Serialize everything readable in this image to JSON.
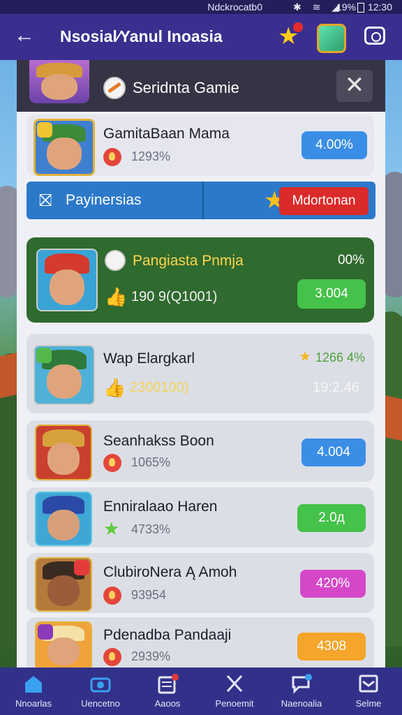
{
  "status_bar": {
    "left": "Ndckrocatb0",
    "battery": "19%",
    "time": "12:30"
  },
  "app_bar": {
    "title": "Nsosial∕Yanul Inoasia"
  },
  "header": {
    "title": "Seridnta Gamie"
  },
  "cards": [
    {
      "name": "GamitaBaan Mama",
      "sub": "1293%",
      "action": "4.00%",
      "color": "#3a8ee6"
    },
    {
      "name": "Pangiasta Pnmja",
      "sub": "190 9(Q1001)",
      "top_right": "00%",
      "action": "3.004",
      "color": "#45c24a"
    },
    {
      "name": "Wap Elargkarl",
      "sub": "2300100)",
      "top_right": "1266 4%",
      "bottom_right": "19:2.46"
    },
    {
      "name": "Seanhakss Boon",
      "sub": "1065%",
      "action": "4.004",
      "color": "#3a8ee6"
    },
    {
      "name": "Enniralaao Haren",
      "sub": "4733%",
      "action": "2.0д",
      "color": "#45c24a"
    },
    {
      "name": "ClubiroNera Ą Amoh",
      "sub": "93954",
      "action": "420%",
      "color": "#d448c8"
    },
    {
      "name": "Pdenadba Pandaaji",
      "sub": "2939%",
      "action": "4308",
      "color": "#f4a52a"
    }
  ],
  "pay_bar": {
    "label": "Payinersias",
    "button": "Mdortonan"
  },
  "bottom_nav": [
    {
      "label": "Nnoarlas",
      "icon": "home-icon"
    },
    {
      "label": "Uencetno",
      "icon": "camera-icon"
    },
    {
      "label": "Aaoos",
      "icon": "news-icon"
    },
    {
      "label": "Penoemit",
      "icon": "tools-icon"
    },
    {
      "label": "Naenoalia",
      "icon": "chat-icon"
    },
    {
      "label": "Selme",
      "icon": "inbox-icon"
    }
  ]
}
